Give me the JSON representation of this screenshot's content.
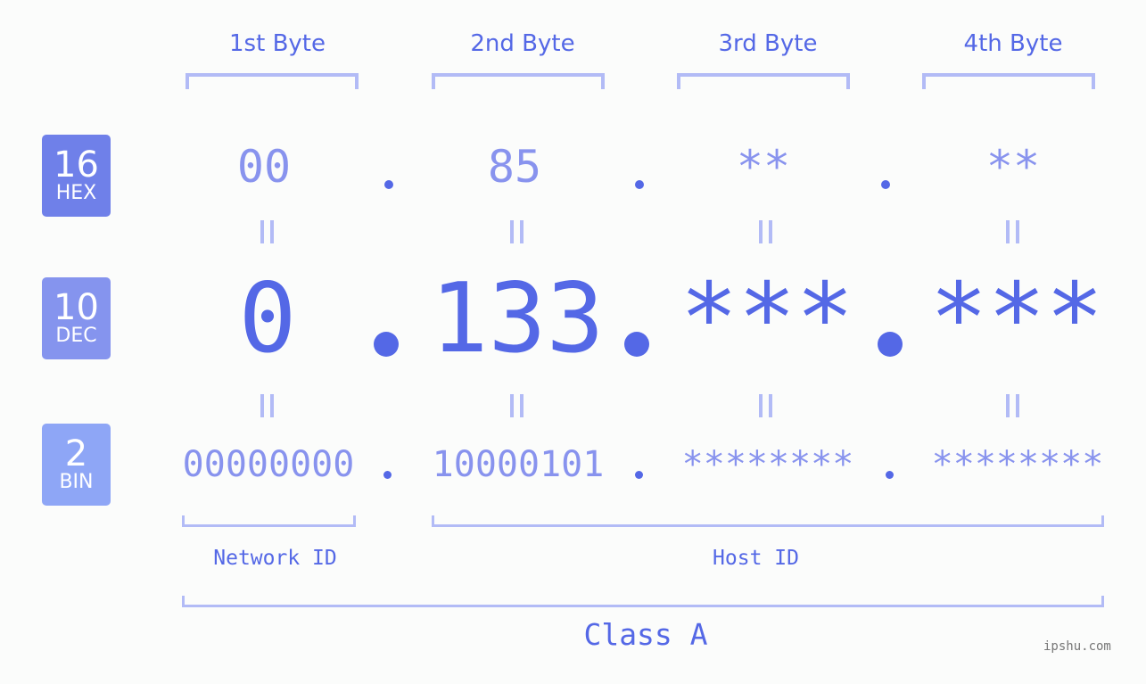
{
  "bytes": [
    {
      "header": "1st Byte",
      "hex": "00",
      "dec": "0",
      "bin": "00000000"
    },
    {
      "header": "2nd Byte",
      "hex": "85",
      "dec": "133",
      "bin": "10000101"
    },
    {
      "header": "3rd Byte",
      "hex": "**",
      "dec": "***",
      "bin": "********"
    },
    {
      "header": "4th Byte",
      "hex": "**",
      "dec": "***",
      "bin": "********"
    }
  ],
  "badges": {
    "hex": {
      "number": "16",
      "label": "HEX"
    },
    "dec": {
      "number": "10",
      "label": "DEC"
    },
    "bin": {
      "number": "2",
      "label": "BIN"
    }
  },
  "labels": {
    "network_id": "Network ID",
    "host_id": "Host ID",
    "class": "Class A"
  },
  "watermark": "ipshu.com",
  "colors": {
    "accent": "#5468e6",
    "light": "#8893ee",
    "bracket": "#b2bbf6",
    "badge_hex": "#6f80e9",
    "badge_dec": "#8594ee",
    "badge_bin": "#8ea6f6"
  }
}
